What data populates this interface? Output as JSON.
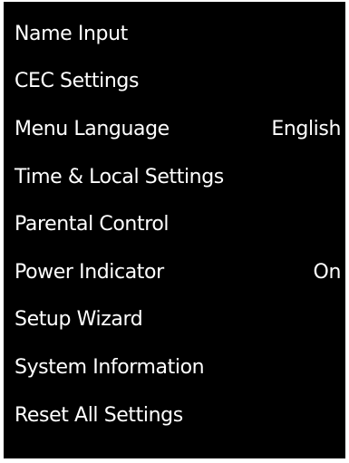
{
  "menu": {
    "items": [
      {
        "label": "Name Input",
        "value": ""
      },
      {
        "label": "CEC Settings",
        "value": ""
      },
      {
        "label": "Menu Language",
        "value": "English"
      },
      {
        "label": "Time & Local Settings",
        "value": ""
      },
      {
        "label": "Parental Control",
        "value": ""
      },
      {
        "label": "Power Indicator",
        "value": "On"
      },
      {
        "label": "Setup Wizard",
        "value": ""
      },
      {
        "label": "System Information",
        "value": ""
      },
      {
        "label": "Reset All Settings",
        "value": ""
      }
    ]
  },
  "colors": {
    "panel_background": "#000000",
    "text": "#ffffff",
    "page_background": "#ffffff"
  }
}
